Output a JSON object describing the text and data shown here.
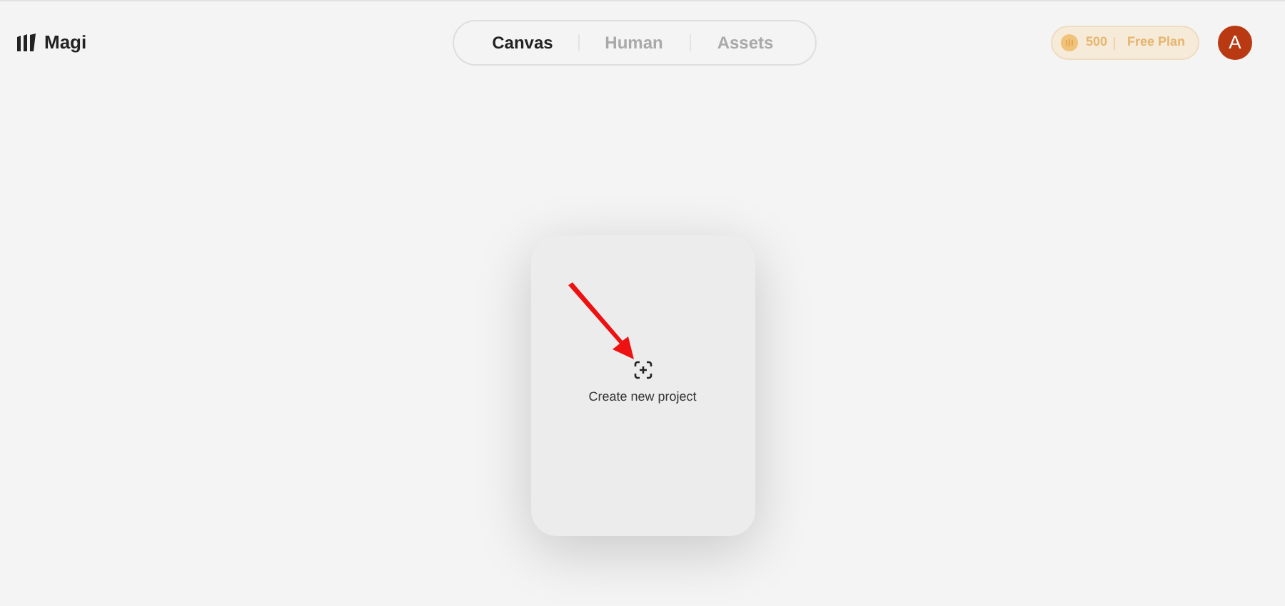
{
  "brand": {
    "name": "Magi"
  },
  "tabs": [
    {
      "label": "Canvas",
      "selected": true
    },
    {
      "label": "Human",
      "selected": false
    },
    {
      "label": "Assets",
      "selected": false
    }
  ],
  "plan": {
    "credits": "500",
    "name": "Free Plan"
  },
  "avatar": {
    "initial": "A"
  },
  "new_project": {
    "label": "Create new project"
  }
}
